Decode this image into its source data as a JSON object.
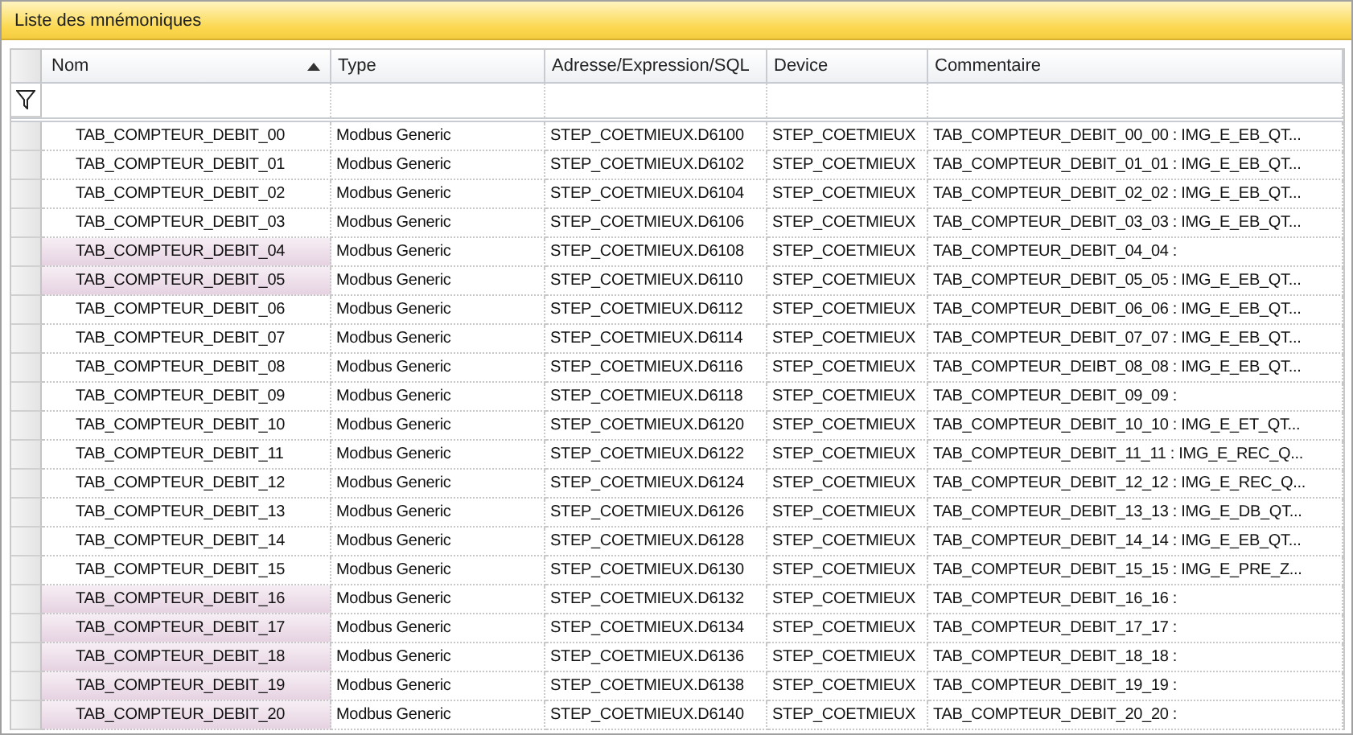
{
  "panel": {
    "title": "Liste des mnémoniques"
  },
  "table": {
    "columns": [
      {
        "label": "Nom",
        "sorted": true
      },
      {
        "label": "Type",
        "sorted": false
      },
      {
        "label": "Adresse/Expression/SQL",
        "sorted": false
      },
      {
        "label": "Device",
        "sorted": false
      },
      {
        "label": "Commentaire",
        "sorted": false
      }
    ],
    "rows": [
      {
        "name": "TAB_COMPTEUR_DEBIT_00",
        "type": "Modbus Generic",
        "address": "STEP_COETMIEUX.D6100",
        "device": "STEP_COETMIEUX",
        "comment": "TAB_COMPTEUR_DEBIT_00_00 : IMG_E_EB_QT...",
        "highlighted": false
      },
      {
        "name": "TAB_COMPTEUR_DEBIT_01",
        "type": "Modbus Generic",
        "address": "STEP_COETMIEUX.D6102",
        "device": "STEP_COETMIEUX",
        "comment": "TAB_COMPTEUR_DEBIT_01_01 : IMG_E_EB_QT...",
        "highlighted": false
      },
      {
        "name": "TAB_COMPTEUR_DEBIT_02",
        "type": "Modbus Generic",
        "address": "STEP_COETMIEUX.D6104",
        "device": "STEP_COETMIEUX",
        "comment": "TAB_COMPTEUR_DEBIT_02_02 : IMG_E_EB_QT...",
        "highlighted": false
      },
      {
        "name": "TAB_COMPTEUR_DEBIT_03",
        "type": "Modbus Generic",
        "address": "STEP_COETMIEUX.D6106",
        "device": "STEP_COETMIEUX",
        "comment": "TAB_COMPTEUR_DEBIT_03_03 : IMG_E_EB_QT...",
        "highlighted": false
      },
      {
        "name": "TAB_COMPTEUR_DEBIT_04",
        "type": "Modbus Generic",
        "address": "STEP_COETMIEUX.D6108",
        "device": "STEP_COETMIEUX",
        "comment": "TAB_COMPTEUR_DEBIT_04_04 :",
        "highlighted": true
      },
      {
        "name": "TAB_COMPTEUR_DEBIT_05",
        "type": "Modbus Generic",
        "address": "STEP_COETMIEUX.D6110",
        "device": "STEP_COETMIEUX",
        "comment": "TAB_COMPTEUR_DEBIT_05_05 : IMG_E_EB_QT...",
        "highlighted": true
      },
      {
        "name": "TAB_COMPTEUR_DEBIT_06",
        "type": "Modbus Generic",
        "address": "STEP_COETMIEUX.D6112",
        "device": "STEP_COETMIEUX",
        "comment": "TAB_COMPTEUR_DEBIT_06_06 : IMG_E_EB_QT...",
        "highlighted": false
      },
      {
        "name": "TAB_COMPTEUR_DEBIT_07",
        "type": "Modbus Generic",
        "address": "STEP_COETMIEUX.D6114",
        "device": "STEP_COETMIEUX",
        "comment": "TAB_COMPTEUR_DEBIT_07_07 : IMG_E_EB_QT...",
        "highlighted": false
      },
      {
        "name": "TAB_COMPTEUR_DEBIT_08",
        "type": "Modbus Generic",
        "address": "STEP_COETMIEUX.D6116",
        "device": "STEP_COETMIEUX",
        "comment": "TAB_COMPTEUR_DEIBT_08_08 : IMG_E_EB_QT...",
        "highlighted": false
      },
      {
        "name": "TAB_COMPTEUR_DEBIT_09",
        "type": "Modbus Generic",
        "address": "STEP_COETMIEUX.D6118",
        "device": "STEP_COETMIEUX",
        "comment": "TAB_COMPTEUR_DEBIT_09_09 :",
        "highlighted": false
      },
      {
        "name": "TAB_COMPTEUR_DEBIT_10",
        "type": "Modbus Generic",
        "address": "STEP_COETMIEUX.D6120",
        "device": "STEP_COETMIEUX",
        "comment": "TAB_COMPTEUR_DEBIT_10_10 : IMG_E_ET_QT...",
        "highlighted": false
      },
      {
        "name": "TAB_COMPTEUR_DEBIT_11",
        "type": "Modbus Generic",
        "address": "STEP_COETMIEUX.D6122",
        "device": "STEP_COETMIEUX",
        "comment": "TAB_COMPTEUR_DEBIT_11_11 : IMG_E_REC_Q...",
        "highlighted": false
      },
      {
        "name": "TAB_COMPTEUR_DEBIT_12",
        "type": "Modbus Generic",
        "address": "STEP_COETMIEUX.D6124",
        "device": "STEP_COETMIEUX",
        "comment": "TAB_COMPTEUR_DEBIT_12_12 : IMG_E_REC_Q...",
        "highlighted": false
      },
      {
        "name": "TAB_COMPTEUR_DEBIT_13",
        "type": "Modbus Generic",
        "address": "STEP_COETMIEUX.D6126",
        "device": "STEP_COETMIEUX",
        "comment": "TAB_COMPTEUR_DEBIT_13_13 : IMG_E_DB_QT...",
        "highlighted": false
      },
      {
        "name": "TAB_COMPTEUR_DEBIT_14",
        "type": "Modbus Generic",
        "address": "STEP_COETMIEUX.D6128",
        "device": "STEP_COETMIEUX",
        "comment": "TAB_COMPTEUR_DEBIT_14_14 : IMG_E_EB_QT...",
        "highlighted": false
      },
      {
        "name": "TAB_COMPTEUR_DEBIT_15",
        "type": "Modbus Generic",
        "address": "STEP_COETMIEUX.D6130",
        "device": "STEP_COETMIEUX",
        "comment": "TAB_COMPTEUR_DEBIT_15_15 : IMG_E_PRE_Z...",
        "highlighted": false
      },
      {
        "name": "TAB_COMPTEUR_DEBIT_16",
        "type": "Modbus Generic",
        "address": "STEP_COETMIEUX.D6132",
        "device": "STEP_COETMIEUX",
        "comment": "TAB_COMPTEUR_DEBIT_16_16 :",
        "highlighted": true
      },
      {
        "name": "TAB_COMPTEUR_DEBIT_17",
        "type": "Modbus Generic",
        "address": "STEP_COETMIEUX.D6134",
        "device": "STEP_COETMIEUX",
        "comment": "TAB_COMPTEUR_DEBIT_17_17 :",
        "highlighted": true
      },
      {
        "name": "TAB_COMPTEUR_DEBIT_18",
        "type": "Modbus Generic",
        "address": "STEP_COETMIEUX.D6136",
        "device": "STEP_COETMIEUX",
        "comment": "TAB_COMPTEUR_DEBIT_18_18 :",
        "highlighted": true
      },
      {
        "name": "TAB_COMPTEUR_DEBIT_19",
        "type": "Modbus Generic",
        "address": "STEP_COETMIEUX.D6138",
        "device": "STEP_COETMIEUX",
        "comment": "TAB_COMPTEUR_DEBIT_19_19 :",
        "highlighted": true
      },
      {
        "name": "TAB_COMPTEUR_DEBIT_20",
        "type": "Modbus Generic",
        "address": "STEP_COETMIEUX.D6140",
        "device": "STEP_COETMIEUX",
        "comment": "TAB_COMPTEUR_DEBIT_20_20 :",
        "highlighted": true
      }
    ]
  }
}
